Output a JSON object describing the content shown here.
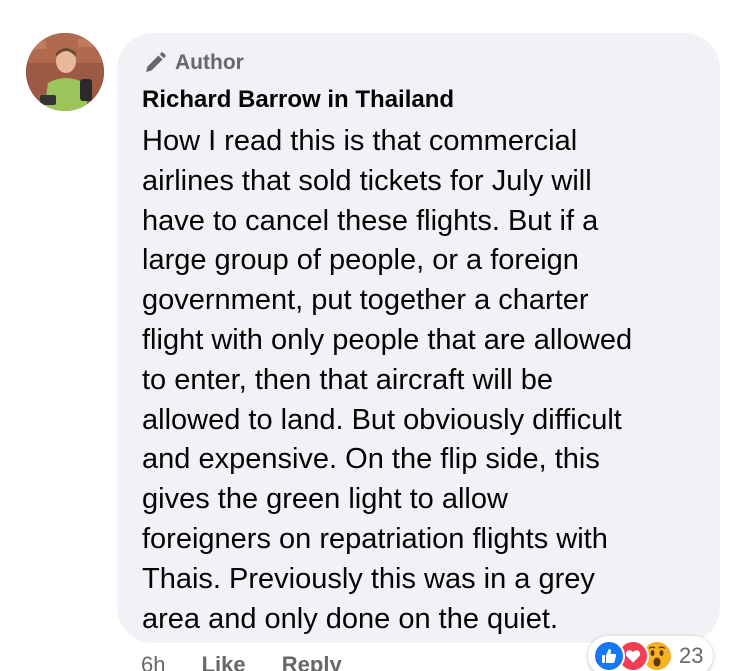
{
  "comment": {
    "badge_label": "Author",
    "author_name": "Richard Barrow in Thailand",
    "body_lines": [
      "How I read this is that commercial",
      "airlines that sold tickets for July will",
      "have to cancel these flights. But if a",
      "large group of people, or a foreign",
      "government, put together a charter",
      "flight with only people that are allowed",
      "to enter, then that aircraft will be",
      "allowed to land. But obviously difficult",
      "and expensive. On the flip side, this",
      "gives the green light to allow",
      "foreigners on repatriation flights with",
      "Thais. Previously this was in a grey",
      "area and only done on the quiet."
    ]
  },
  "footer": {
    "time": "6h",
    "like_label": "Like",
    "reply_label": "Reply"
  },
  "reactions": {
    "icons": [
      "like-icon",
      "love-icon",
      "wow-icon"
    ],
    "count": "23"
  },
  "colors": {
    "bubble_bg": "#f0f2f5",
    "text": "#050505",
    "secondary_text": "#65676b",
    "like": "#1877f2",
    "love": "#f33e58",
    "wow": "#f7b125"
  }
}
